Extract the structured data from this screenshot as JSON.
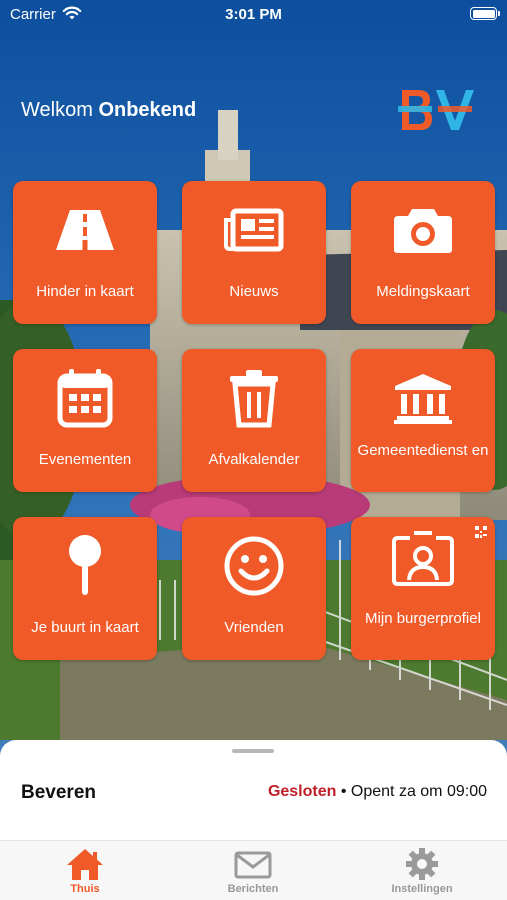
{
  "status_bar": {
    "carrier": "Carrier",
    "time": "3:01 PM"
  },
  "header": {
    "welcome_prefix": "Welkom",
    "user_name": "Onbekend"
  },
  "tiles": [
    {
      "label": "Hinder in kaart",
      "icon": "road-icon"
    },
    {
      "label": "Nieuws",
      "icon": "newspaper-icon"
    },
    {
      "label": "Meldingskaart",
      "icon": "camera-icon"
    },
    {
      "label": "Evenementen",
      "icon": "calendar-icon"
    },
    {
      "label": "Afvalkalender",
      "icon": "trash-icon"
    },
    {
      "label": "Gemeentedienst en",
      "icon": "government-building-icon"
    },
    {
      "label": "Je buurt in kaart",
      "icon": "map-pin-icon"
    },
    {
      "label": "Vrienden",
      "icon": "smiley-icon"
    },
    {
      "label": "Mijn burgerprofiel",
      "icon": "profile-id-icon"
    }
  ],
  "location_sheet": {
    "city": "Beveren",
    "state": "Gesloten",
    "separator": " • ",
    "next_open": "Opent za om 09:00"
  },
  "tabbar": {
    "items": [
      {
        "label": "Thuis",
        "icon": "home-icon",
        "active": true
      },
      {
        "label": "Berichten",
        "icon": "mail-icon",
        "active": false
      },
      {
        "label": "Instellingen",
        "icon": "gear-icon",
        "active": false
      }
    ]
  },
  "colors": {
    "accent": "#f05a28",
    "closed": "#c0202a",
    "logo_orange": "#f05a28",
    "logo_blue": "#2fb6e6"
  }
}
